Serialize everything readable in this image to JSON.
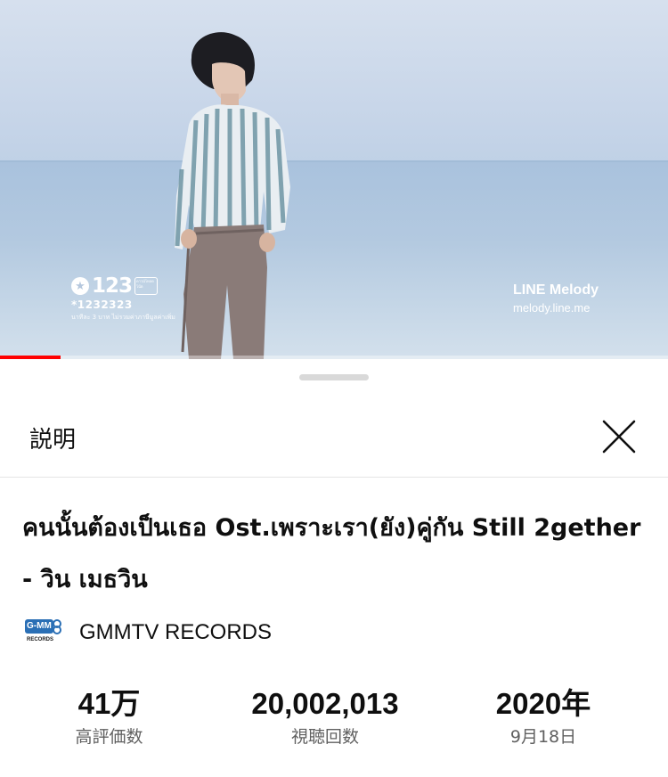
{
  "video": {
    "overlay_left": {
      "logo_text": "123",
      "code": "*1232323",
      "box_text": "ดาวน์โหลดโน้ต",
      "fine_print": "นาทีละ 3 บาท ไม่รวมค่าภาษีมูลค่าเพิ่ม"
    },
    "overlay_right": {
      "line1": "LINE Melody",
      "line2": "melody.line.me"
    },
    "progress": 0.09
  },
  "sheet": {
    "title": "説明",
    "video_title": "คนนั้นต้องเป็นเธอ Ost.เพราะเรา(ยัง)คู่กัน Still 2gether - วิน เมธวิน",
    "channel": {
      "logo_text_top": "G-MM",
      "logo_text_bottom": "RECORDS",
      "name": "GMMTV RECORDS"
    },
    "stats": [
      {
        "value": "41万",
        "label": "高評価数"
      },
      {
        "value": "20,002,013",
        "label": "視聴回数"
      },
      {
        "value": "2020年",
        "label": "9月18日"
      }
    ]
  },
  "colors": {
    "progress": "#ff0000",
    "text_primary": "#0f0f0f",
    "text_secondary": "#606060",
    "channel_logo": "#2a6fb5"
  }
}
